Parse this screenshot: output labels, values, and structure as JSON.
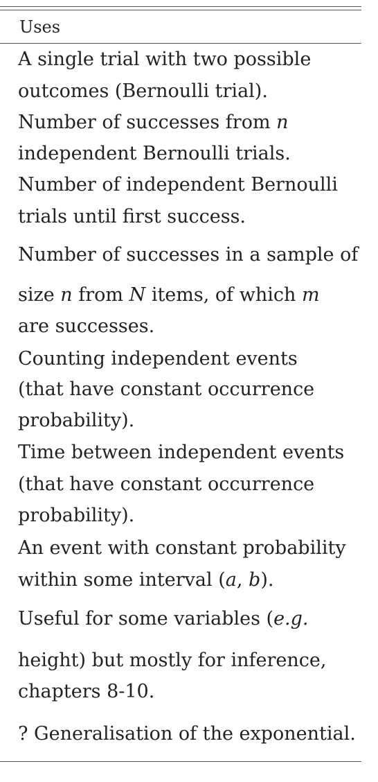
{
  "table": {
    "header": "Uses",
    "rows": [
      {
        "id": "bernoulli",
        "lines": [
          [
            "A single trial with two possible"
          ],
          [
            "outcomes (Bernoulli trial)."
          ]
        ]
      },
      {
        "id": "binomial",
        "lines": [
          [
            "Number of successes from ",
            "n"
          ],
          [
            "independent Bernoulli trials."
          ]
        ]
      },
      {
        "id": "geometric",
        "lines": [
          [
            "Number of independent Bernoulli"
          ],
          [
            "trials until first success."
          ]
        ]
      },
      {
        "id": "hypergeometric",
        "lines": [
          [
            "Number of successes in a sample of"
          ],
          [
            "size ",
            "n",
            " from ",
            "N",
            " items, of which ",
            "m"
          ],
          [
            "are successes."
          ]
        ]
      },
      {
        "id": "poisson",
        "lines": [
          [
            "Counting independent events"
          ],
          [
            "(that have constant occurrence"
          ],
          [
            "probability)."
          ]
        ]
      },
      {
        "id": "exponential",
        "lines": [
          [
            "Time between independent events"
          ],
          [
            "(that have constant occurrence"
          ],
          [
            "probability)."
          ]
        ]
      },
      {
        "id": "uniform",
        "lines": [
          [
            "An event with constant probability"
          ],
          [
            "within some interval (",
            "a",
            ", ",
            "b",
            ")."
          ]
        ]
      },
      {
        "id": "normal",
        "lines": [
          [
            "Useful for some variables (",
            "e.g."
          ],
          [
            "height) but mostly for inference,"
          ],
          [
            "chapters 8-10."
          ]
        ]
      },
      {
        "id": "gamma",
        "lines": [
          [
            "? Generalisation of the exponential."
          ]
        ]
      }
    ]
  }
}
